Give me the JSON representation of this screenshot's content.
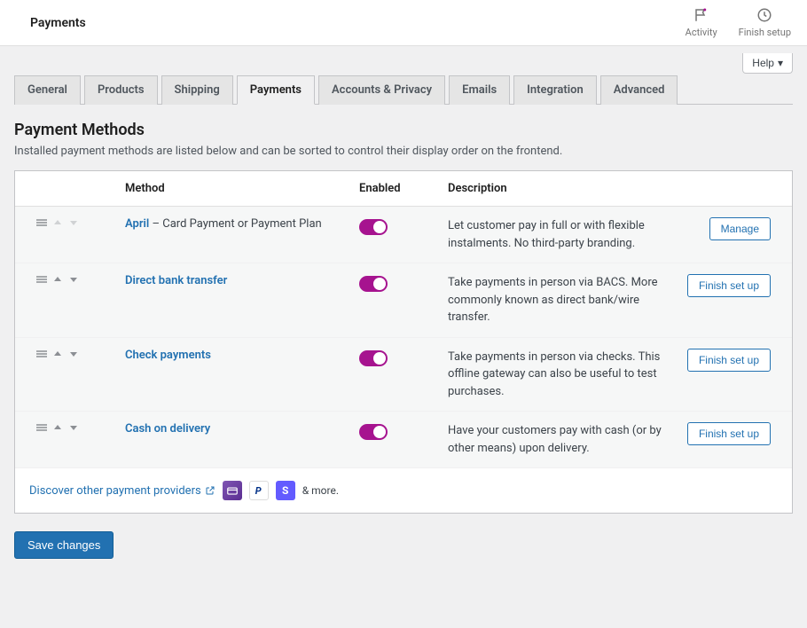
{
  "topbar": {
    "title": "Payments",
    "activity_label": "Activity",
    "finish_setup_label": "Finish setup"
  },
  "help_label": "Help",
  "tabs": [
    {
      "label": "General",
      "active": false
    },
    {
      "label": "Products",
      "active": false
    },
    {
      "label": "Shipping",
      "active": false
    },
    {
      "label": "Payments",
      "active": true
    },
    {
      "label": "Accounts & Privacy",
      "active": false
    },
    {
      "label": "Emails",
      "active": false
    },
    {
      "label": "Integration",
      "active": false
    },
    {
      "label": "Advanced",
      "active": false
    }
  ],
  "section": {
    "title": "Payment Methods",
    "description": "Installed payment methods are listed below and can be sorted to control their display order on the frontend."
  },
  "columns": {
    "method": "Method",
    "enabled": "Enabled",
    "description": "Description"
  },
  "rows": [
    {
      "name": "April",
      "extra": " – Card Payment or Payment Plan",
      "enabled": true,
      "arrows_dim": true,
      "description": "Let customer pay in full or with flexible instalments. No third-party branding.",
      "action": "Manage"
    },
    {
      "name": "Direct bank transfer",
      "extra": "",
      "enabled": true,
      "arrows_dim": false,
      "description": "Take payments in person via BACS. More commonly known as direct bank/wire transfer.",
      "action": "Finish set up"
    },
    {
      "name": "Check payments",
      "extra": "",
      "enabled": true,
      "arrows_dim": false,
      "description": "Take payments in person via checks. This offline gateway can also be useful to test purchases.",
      "action": "Finish set up"
    },
    {
      "name": "Cash on delivery",
      "extra": "",
      "enabled": true,
      "arrows_dim": false,
      "description": "Have your customers pay with cash (or by other means) upon delivery.",
      "action": "Finish set up"
    }
  ],
  "discover": {
    "link_text": "Discover other payment providers",
    "and_more": "& more."
  },
  "save_button": "Save changes"
}
